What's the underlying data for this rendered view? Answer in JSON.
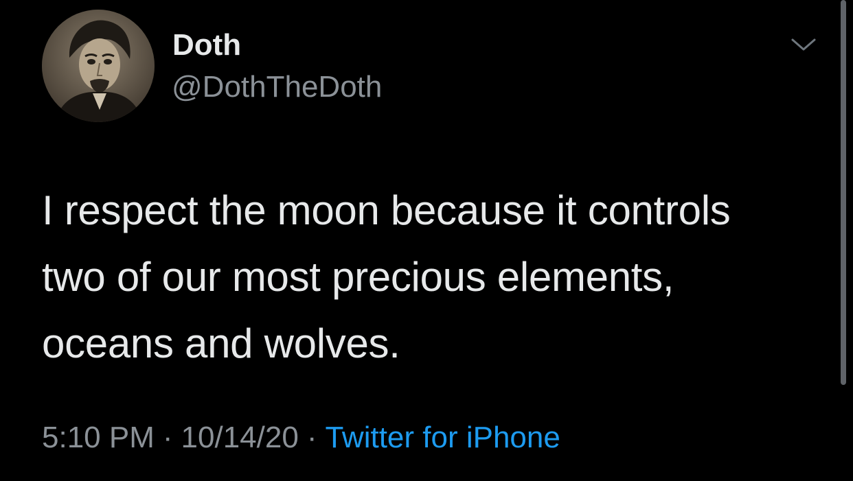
{
  "tweet": {
    "author": {
      "display_name": "Doth",
      "handle": "@DothTheDoth",
      "avatar": "portrait-avatar"
    },
    "menu_icon": "chevron-down-icon",
    "text_lines": [
      "I respect the moon because it controls",
      "two of our most precious elements,",
      "oceans and wolves."
    ],
    "meta": {
      "time": "5:10 PM",
      "separator": "·",
      "date": "10/14/20",
      "source": "Twitter for iPhone"
    }
  },
  "colors": {
    "background": "#000000",
    "text_primary": "#e7e9ea",
    "text_secondary": "#8b9197",
    "link": "#1d9bf0"
  }
}
